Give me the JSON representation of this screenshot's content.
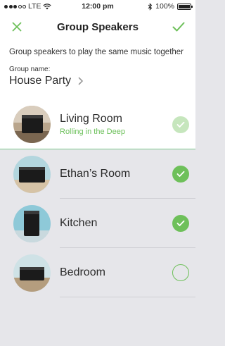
{
  "status_bar": {
    "carrier": "LTE",
    "time": "12:00 pm",
    "battery": "100%",
    "battery_level": 1.0
  },
  "nav": {
    "title": "Group Speakers",
    "close_icon": "close-icon",
    "confirm_icon": "checkmark-icon"
  },
  "header": {
    "description": "Group speakers to play the same music together",
    "group_name_label": "Group name:",
    "group_name_value": "House Party"
  },
  "rooms": [
    {
      "name": "Living Room",
      "subtitle": "Rolling in the Deep",
      "selected": true,
      "state": "current"
    },
    {
      "name": "Ethan’s Room",
      "selected": true,
      "state": "selected"
    },
    {
      "name": "Kitchen",
      "selected": true,
      "state": "selected"
    },
    {
      "name": "Bedroom",
      "selected": false,
      "state": "unselected"
    }
  ],
  "colors": {
    "accent": "#6ec05a",
    "background": "#e6e6ea"
  }
}
